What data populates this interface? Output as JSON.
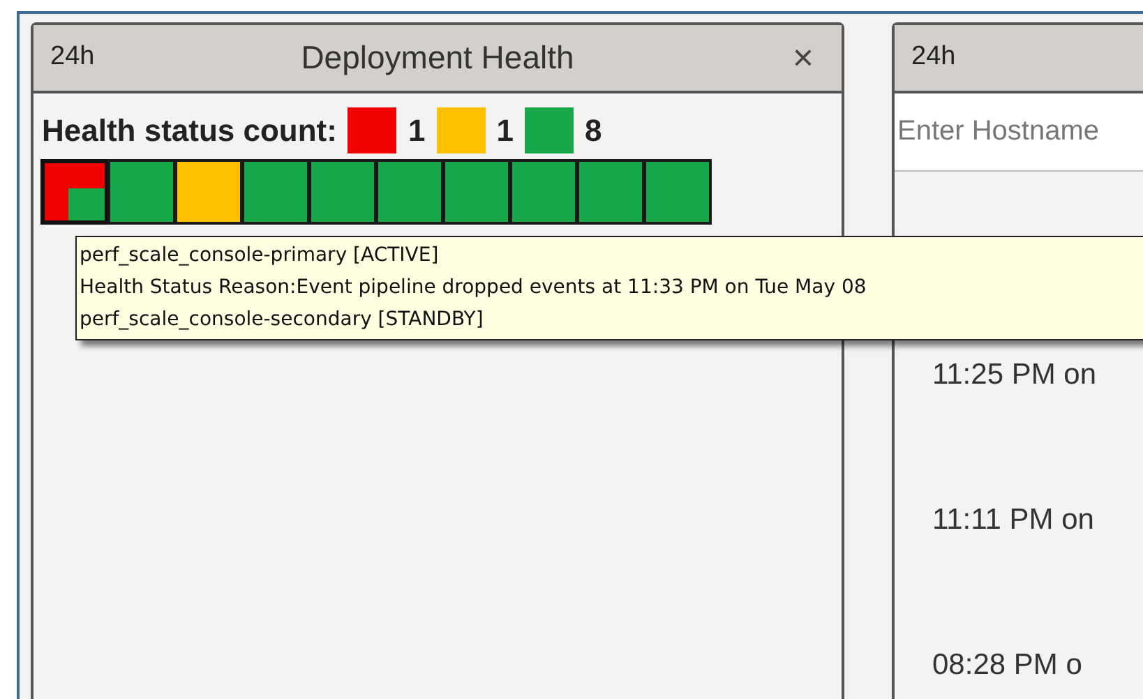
{
  "left_panel": {
    "range": "24h",
    "title": "Deployment Health",
    "close": "×",
    "summary_label": "Health status count:",
    "legend": [
      {
        "color": "#f00000",
        "count": "1"
      },
      {
        "color": "#ffc000",
        "count": "1"
      },
      {
        "color": "#18a84a",
        "count": "8"
      }
    ],
    "cells": [
      {
        "color": "#f00000",
        "inset": {
          "color": "#18a84a"
        },
        "selected": true
      },
      {
        "color": "#18a84a",
        "selected": false
      },
      {
        "color": "#ffc000",
        "selected": false
      },
      {
        "color": "#18a84a",
        "selected": false
      },
      {
        "color": "#18a84a",
        "selected": false
      },
      {
        "color": "#18a84a",
        "selected": false
      },
      {
        "color": "#18a84a",
        "selected": false
      },
      {
        "color": "#18a84a",
        "selected": false
      },
      {
        "color": "#18a84a",
        "selected": false
      },
      {
        "color": "#18a84a",
        "selected": false
      }
    ]
  },
  "tooltip": {
    "lines": [
      "perf_scale_console-primary [ACTIVE]",
      "Health Status Reason:Event pipeline dropped events at 11:33 PM on Tue May 08",
      "perf_scale_console-secondary [STANDBY]"
    ]
  },
  "right_panel": {
    "range": "24h",
    "search": {
      "placeholder": "Enter Hostname"
    },
    "times": [
      "11:25 PM on",
      "11:11 PM on",
      "08:28 PM o"
    ]
  }
}
